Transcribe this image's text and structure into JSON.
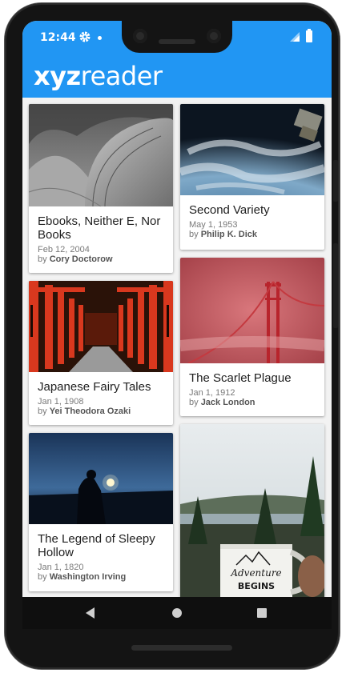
{
  "status_bar": {
    "time": "12:44",
    "gear_icon": "gear-icon",
    "signal_icon": "signal-icon",
    "battery_icon": "battery-icon"
  },
  "app_bar": {
    "logo_bold": "xyz",
    "logo_light": "reader",
    "color": "#2196f3"
  },
  "books": [
    {
      "title": "Ebooks, Neither E, Nor Books",
      "date": "Feb 12, 2004",
      "by": "by",
      "author": "Cory Doctorow",
      "image": "architecture-photo"
    },
    {
      "title": "Second Variety",
      "date": "May 1, 1953",
      "by": "by",
      "author": "Philip K. Dick",
      "image": "earth-from-space-photo"
    },
    {
      "title": "Japanese Fairy Tales",
      "date": "Jan 1, 1908",
      "by": "by",
      "author": "Yei Theodora Ozaki",
      "image": "torii-gates-photo"
    },
    {
      "title": "The Scarlet Plague",
      "date": "Jan 1, 1912",
      "by": "by",
      "author": "Jack London",
      "image": "red-bridge-fog-photo"
    },
    {
      "title": "The Legend of Sleepy Hollow",
      "date": "Jan 1, 1820",
      "by": "by",
      "author": "Washington Irving",
      "image": "lantern-night-photo"
    },
    {
      "title": "",
      "date": "",
      "by": "",
      "author": "",
      "image": "adventure-mug-lake-photo"
    }
  ],
  "mug_text": {
    "line1": "Adventure",
    "line2": "BEGINS"
  },
  "nav_bar": {
    "back": "back-icon",
    "home": "home-icon",
    "recents": "recents-icon"
  }
}
